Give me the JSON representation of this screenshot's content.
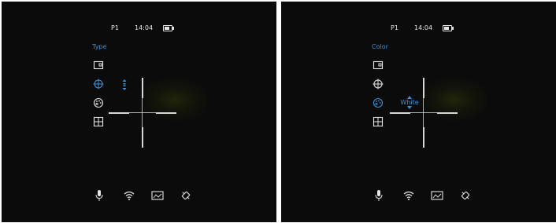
{
  "panels": [
    {
      "status": {
        "profile": "P1",
        "time": "14:04"
      },
      "menu_title": "Type",
      "side_icons": [
        "aspect-ratio-icon",
        "crosshair-icon",
        "palette-icon",
        "grid-icon"
      ],
      "selected_icon": "crosshair-icon",
      "value_text": "",
      "bottom_icons": [
        "microphone-icon",
        "wifi-icon",
        "rangefinder-icon",
        "pin-icon"
      ]
    },
    {
      "status": {
        "profile": "P1",
        "time": "14:04"
      },
      "menu_title": "Color",
      "side_icons": [
        "aspect-ratio-icon",
        "crosshair-icon",
        "palette-icon",
        "grid-icon"
      ],
      "selected_icon": "palette-icon",
      "value_text": "White",
      "bottom_icons": [
        "microphone-icon",
        "wifi-icon",
        "rangefinder-icon",
        "pin-icon"
      ]
    }
  ],
  "colors": {
    "accent": "#3d8fd6",
    "foreground": "#e6e6e6",
    "background": "#0b0b0b"
  }
}
